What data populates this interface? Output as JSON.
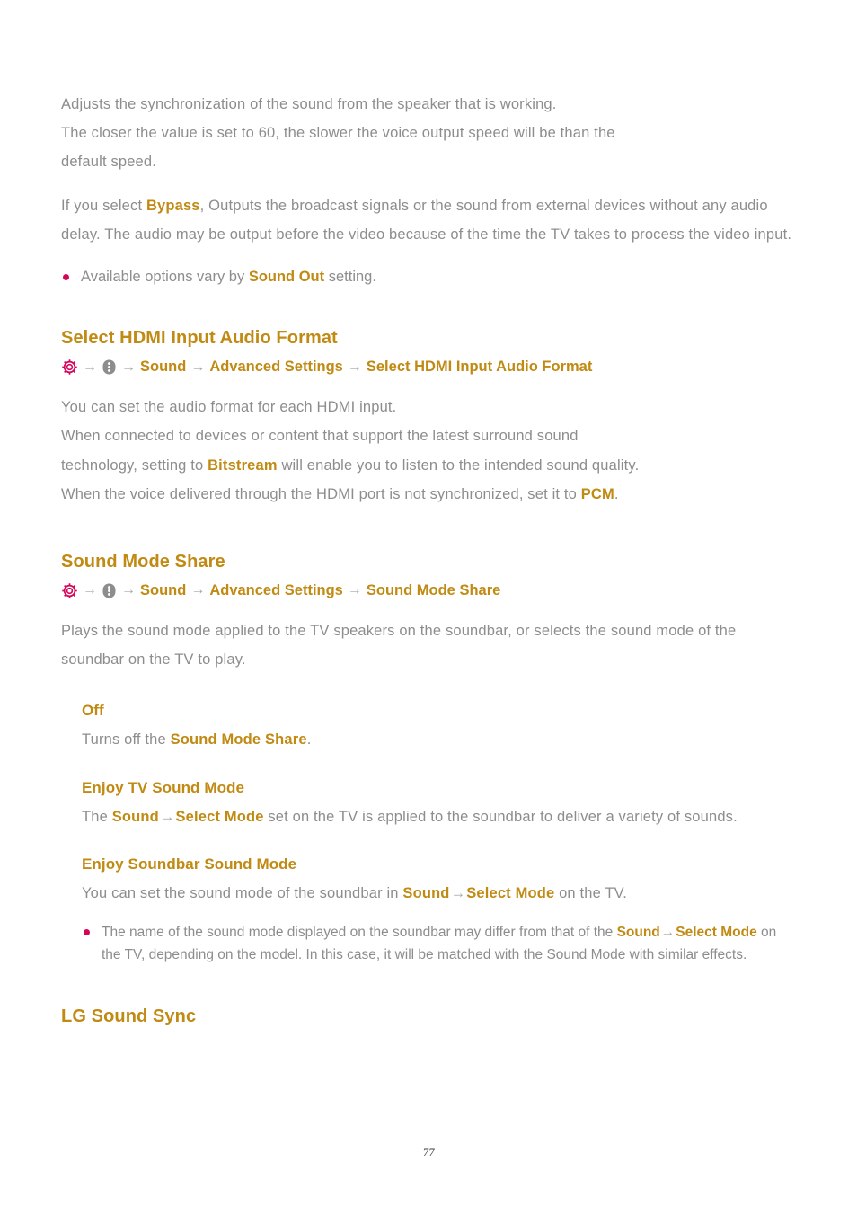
{
  "colors": {
    "accent_gold": "#c08a13",
    "body_gray": "#8d8d8d",
    "bullet_crimson": "#d5055c",
    "gear_icon_red": "#d5055c",
    "dots_icon_gray": "#8d8d8d",
    "arrow_gray": "#a7a7a7",
    "page_background": "#ffffff"
  },
  "intro": {
    "para1_line1": "Adjusts the synchronization of the sound from the speaker that is working.",
    "para1_line2": "The closer the value is set to 60, the slower the voice output speed will be than the",
    "para1_line3": "default speed.",
    "para2_a": "If you select ",
    "para2_bold": "Bypass",
    "para2_b": ", Outputs the broadcast signals or the sound from external devices without any audio delay. The audio may be output before the video because of the time the TV takes to process the video input.",
    "note_a": "Available options vary by ",
    "note_bold": "Sound Out",
    "note_b": " setting."
  },
  "section_hdmi": {
    "heading": "Select HDMI Input Audio Format",
    "breadcrumb": {
      "icon1": "gear-icon",
      "icon2": "three-dots-icon",
      "arrow": "→",
      "items": [
        "Sound",
        "Advanced Settings",
        "Select HDMI Input Audio Format"
      ]
    },
    "body_line1": "You can set the audio format for each HDMI input.",
    "body_line2": "When connected to devices or content that support the latest surround sound",
    "body_line3_a": "technology, setting to ",
    "body_line3_bold": "Bitstream",
    "body_line3_b": " will enable you to listen to the intended sound quality.",
    "body_line4_a": "When the voice delivered through the HDMI port is not synchronized, set it to ",
    "body_line4_bold": "PCM",
    "body_line4_b": "."
  },
  "section_share": {
    "heading": "Sound Mode Share",
    "breadcrumb": {
      "icon1": "gear-icon",
      "icon2": "three-dots-icon",
      "arrow": "→",
      "items": [
        "Sound",
        "Advanced Settings",
        "Sound Mode Share"
      ]
    },
    "body": "Plays the sound mode applied to the TV speakers on the soundbar, or selects the sound mode of the soundbar on the TV to play.",
    "subsections": [
      {
        "heading": "Off",
        "body_a": "Turns off the ",
        "body_bold": "Sound Mode Share",
        "body_b": "."
      },
      {
        "heading": "Enjoy TV Sound Mode",
        "body_a": "The ",
        "body_bold1": "Sound",
        "body_arrow": "→",
        "body_bold2": "Select Mode",
        "body_b": " set on the TV is applied to the soundbar to deliver a variety of sounds."
      },
      {
        "heading": "Enjoy Soundbar Sound Mode",
        "body_a": "You can set the sound mode of the soundbar in ",
        "body_bold1": "Sound",
        "body_arrow": "→",
        "body_bold2": "Select Mode",
        "body_b": " on the TV.",
        "note_a": "The name of the sound mode displayed on the soundbar may differ from that of the ",
        "note_bold1": "Sound",
        "note_arrow": "→",
        "note_bold2": "Select Mode",
        "note_b": " on the TV, depending on the model. In this case, it will be matched with the Sound Mode with similar effects."
      }
    ]
  },
  "section_sync": {
    "heading": "LG Sound Sync"
  },
  "footer": {
    "page_number": "77"
  }
}
